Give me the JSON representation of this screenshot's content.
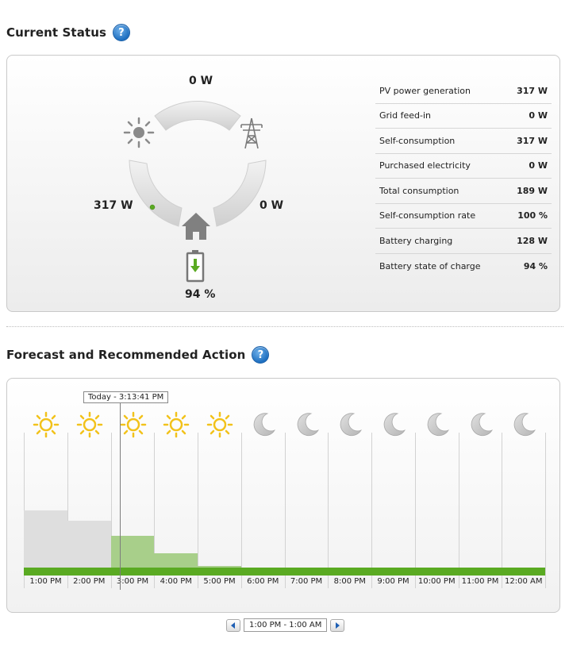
{
  "current_status": {
    "title": "Current Status",
    "help_label": "?",
    "diagram": {
      "grid_flow": "0 W",
      "pv_flow": "317 W",
      "house_flow": "0 W",
      "battery_soc": "94 %"
    },
    "metrics": [
      {
        "label": "PV power generation",
        "value": "317 W"
      },
      {
        "label": "Grid feed-in",
        "value": "0 W"
      },
      {
        "label": "Self-consumption",
        "value": "317 W"
      },
      {
        "label": "Purchased electricity",
        "value": "0 W"
      },
      {
        "label": "Total consumption",
        "value": "189 W"
      },
      {
        "label": "Self-consumption rate",
        "value": "100 %"
      },
      {
        "label": "Battery charging",
        "value": "128 W"
      },
      {
        "label": "Battery state of charge",
        "value": "94 %"
      }
    ]
  },
  "forecast": {
    "title": "Forecast and Recommended Action",
    "help_label": "?",
    "now_label": "Today - 3:13:41 PM",
    "slots": [
      {
        "time": "1:00 PM",
        "icon": "sun-icon",
        "gray": 0.45,
        "green": 0
      },
      {
        "time": "2:00 PM",
        "icon": "sun-icon",
        "gray": 0.37,
        "green": 0
      },
      {
        "time": "3:00 PM",
        "icon": "sun-icon",
        "gray": 0,
        "green": 0.25
      },
      {
        "time": "4:00 PM",
        "icon": "sun-icon",
        "gray": 0,
        "green": 0.11
      },
      {
        "time": "5:00 PM",
        "icon": "sun-icon",
        "gray": 0,
        "green": 0.01
      },
      {
        "time": "6:00 PM",
        "icon": "moon-icon",
        "gray": 0,
        "green": 0
      },
      {
        "time": "7:00 PM",
        "icon": "moon-icon",
        "gray": 0,
        "green": 0
      },
      {
        "time": "8:00 PM",
        "icon": "moon-icon",
        "gray": 0,
        "green": 0
      },
      {
        "time": "9:00 PM",
        "icon": "moon-icon",
        "gray": 0,
        "green": 0
      },
      {
        "time": "10:00 PM",
        "icon": "moon-icon",
        "gray": 0,
        "green": 0
      },
      {
        "time": "11:00 PM",
        "icon": "moon-icon",
        "gray": 0,
        "green": 0
      },
      {
        "time": "12:00 AM",
        "icon": "moon-icon",
        "gray": 0,
        "green": 0
      }
    ],
    "range_label": "1:00 PM - 1:00 AM"
  },
  "colors": {
    "accent_green": "#5aaa22",
    "light_green": "#a8cf8a",
    "bar_gray": "#dedede",
    "sun": "#f2c21b",
    "moon": "#b5b5b5",
    "help_blue": "#1e6fc0"
  }
}
